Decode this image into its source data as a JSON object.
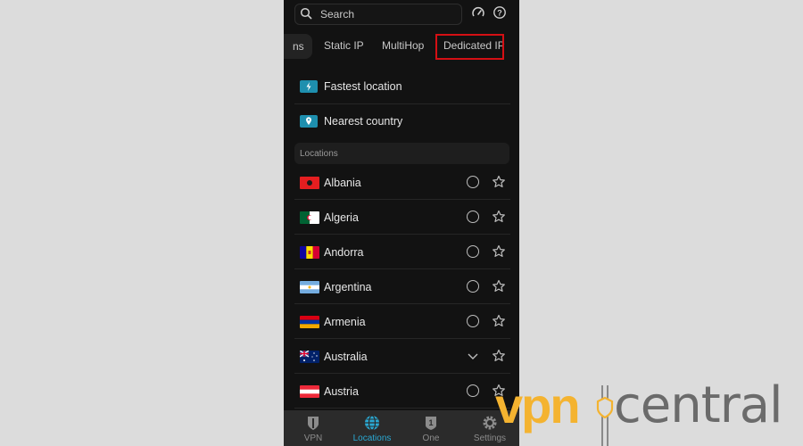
{
  "search": {
    "placeholder": "Search"
  },
  "tabs": [
    {
      "label": "ns",
      "truncated": true
    },
    {
      "label": "Static IP"
    },
    {
      "label": "MultiHop"
    },
    {
      "label": "Dedicated IP",
      "highlighted": true
    }
  ],
  "quick_actions": [
    {
      "label": "Fastest location",
      "icon": "bolt-icon"
    },
    {
      "label": "Nearest country",
      "icon": "location-pin-icon"
    }
  ],
  "section_header": "Locations",
  "locations": [
    {
      "name": "Albania",
      "control": "radio"
    },
    {
      "name": "Algeria",
      "control": "radio"
    },
    {
      "name": "Andorra",
      "control": "radio"
    },
    {
      "name": "Argentina",
      "control": "radio"
    },
    {
      "name": "Armenia",
      "control": "radio"
    },
    {
      "name": "Australia",
      "control": "chevron-down"
    },
    {
      "name": "Austria",
      "control": "radio"
    }
  ],
  "bottom_nav": [
    {
      "label": "VPN",
      "icon": "shield-icon"
    },
    {
      "label": "Locations",
      "icon": "globe-icon",
      "active": true
    },
    {
      "label": "One",
      "icon": "one-badge-icon"
    },
    {
      "label": "Settings",
      "icon": "gear-icon"
    }
  ],
  "watermark": {
    "part1": "vpn",
    "part2": "central"
  },
  "colors": {
    "accent": "#2aa8d2",
    "highlight_box": "#d40f14",
    "logo_yellow": "#f4b330",
    "logo_gray": "#6b6b6b"
  }
}
